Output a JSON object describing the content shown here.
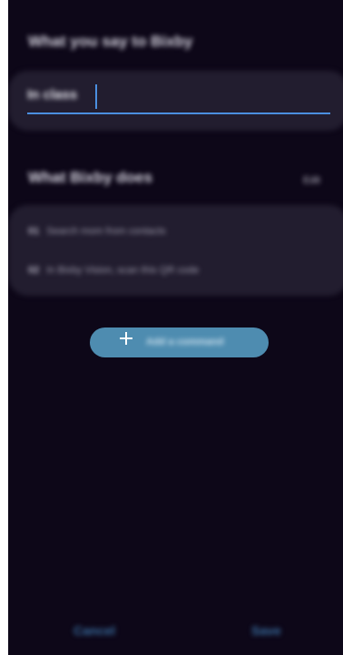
{
  "phrase_section": {
    "title": "What you say to Bixby",
    "value": "In class"
  },
  "commands_section": {
    "title": "What Bixby does",
    "edit_label": "Edit",
    "commands": [
      {
        "number": "01",
        "text": "Search mom from contacts"
      },
      {
        "number": "02",
        "text": "In Bixby Vision, scan this QR code"
      }
    ]
  },
  "add_command": {
    "label": "Add a command"
  },
  "footer": {
    "cancel_label": "Cancel",
    "save_label": "Save"
  }
}
